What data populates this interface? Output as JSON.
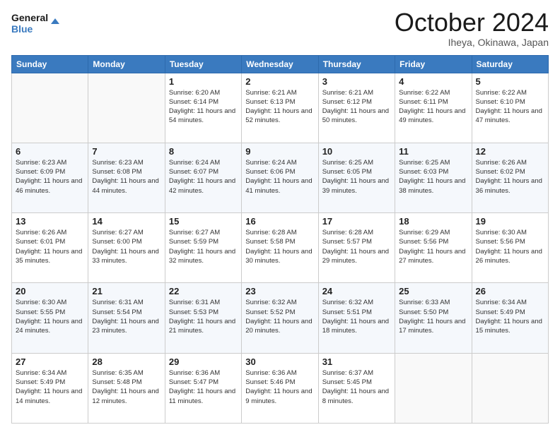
{
  "header": {
    "logo_line1": "General",
    "logo_line2": "Blue",
    "month_title": "October 2024",
    "location": "Iheya, Okinawa, Japan"
  },
  "weekdays": [
    "Sunday",
    "Monday",
    "Tuesday",
    "Wednesday",
    "Thursday",
    "Friday",
    "Saturday"
  ],
  "weeks": [
    [
      {
        "day": "",
        "info": ""
      },
      {
        "day": "",
        "info": ""
      },
      {
        "day": "1",
        "info": "Sunrise: 6:20 AM\nSunset: 6:14 PM\nDaylight: 11 hours and 54 minutes."
      },
      {
        "day": "2",
        "info": "Sunrise: 6:21 AM\nSunset: 6:13 PM\nDaylight: 11 hours and 52 minutes."
      },
      {
        "day": "3",
        "info": "Sunrise: 6:21 AM\nSunset: 6:12 PM\nDaylight: 11 hours and 50 minutes."
      },
      {
        "day": "4",
        "info": "Sunrise: 6:22 AM\nSunset: 6:11 PM\nDaylight: 11 hours and 49 minutes."
      },
      {
        "day": "5",
        "info": "Sunrise: 6:22 AM\nSunset: 6:10 PM\nDaylight: 11 hours and 47 minutes."
      }
    ],
    [
      {
        "day": "6",
        "info": "Sunrise: 6:23 AM\nSunset: 6:09 PM\nDaylight: 11 hours and 46 minutes."
      },
      {
        "day": "7",
        "info": "Sunrise: 6:23 AM\nSunset: 6:08 PM\nDaylight: 11 hours and 44 minutes."
      },
      {
        "day": "8",
        "info": "Sunrise: 6:24 AM\nSunset: 6:07 PM\nDaylight: 11 hours and 42 minutes."
      },
      {
        "day": "9",
        "info": "Sunrise: 6:24 AM\nSunset: 6:06 PM\nDaylight: 11 hours and 41 minutes."
      },
      {
        "day": "10",
        "info": "Sunrise: 6:25 AM\nSunset: 6:05 PM\nDaylight: 11 hours and 39 minutes."
      },
      {
        "day": "11",
        "info": "Sunrise: 6:25 AM\nSunset: 6:03 PM\nDaylight: 11 hours and 38 minutes."
      },
      {
        "day": "12",
        "info": "Sunrise: 6:26 AM\nSunset: 6:02 PM\nDaylight: 11 hours and 36 minutes."
      }
    ],
    [
      {
        "day": "13",
        "info": "Sunrise: 6:26 AM\nSunset: 6:01 PM\nDaylight: 11 hours and 35 minutes."
      },
      {
        "day": "14",
        "info": "Sunrise: 6:27 AM\nSunset: 6:00 PM\nDaylight: 11 hours and 33 minutes."
      },
      {
        "day": "15",
        "info": "Sunrise: 6:27 AM\nSunset: 5:59 PM\nDaylight: 11 hours and 32 minutes."
      },
      {
        "day": "16",
        "info": "Sunrise: 6:28 AM\nSunset: 5:58 PM\nDaylight: 11 hours and 30 minutes."
      },
      {
        "day": "17",
        "info": "Sunrise: 6:28 AM\nSunset: 5:57 PM\nDaylight: 11 hours and 29 minutes."
      },
      {
        "day": "18",
        "info": "Sunrise: 6:29 AM\nSunset: 5:56 PM\nDaylight: 11 hours and 27 minutes."
      },
      {
        "day": "19",
        "info": "Sunrise: 6:30 AM\nSunset: 5:56 PM\nDaylight: 11 hours and 26 minutes."
      }
    ],
    [
      {
        "day": "20",
        "info": "Sunrise: 6:30 AM\nSunset: 5:55 PM\nDaylight: 11 hours and 24 minutes."
      },
      {
        "day": "21",
        "info": "Sunrise: 6:31 AM\nSunset: 5:54 PM\nDaylight: 11 hours and 23 minutes."
      },
      {
        "day": "22",
        "info": "Sunrise: 6:31 AM\nSunset: 5:53 PM\nDaylight: 11 hours and 21 minutes."
      },
      {
        "day": "23",
        "info": "Sunrise: 6:32 AM\nSunset: 5:52 PM\nDaylight: 11 hours and 20 minutes."
      },
      {
        "day": "24",
        "info": "Sunrise: 6:32 AM\nSunset: 5:51 PM\nDaylight: 11 hours and 18 minutes."
      },
      {
        "day": "25",
        "info": "Sunrise: 6:33 AM\nSunset: 5:50 PM\nDaylight: 11 hours and 17 minutes."
      },
      {
        "day": "26",
        "info": "Sunrise: 6:34 AM\nSunset: 5:49 PM\nDaylight: 11 hours and 15 minutes."
      }
    ],
    [
      {
        "day": "27",
        "info": "Sunrise: 6:34 AM\nSunset: 5:49 PM\nDaylight: 11 hours and 14 minutes."
      },
      {
        "day": "28",
        "info": "Sunrise: 6:35 AM\nSunset: 5:48 PM\nDaylight: 11 hours and 12 minutes."
      },
      {
        "day": "29",
        "info": "Sunrise: 6:36 AM\nSunset: 5:47 PM\nDaylight: 11 hours and 11 minutes."
      },
      {
        "day": "30",
        "info": "Sunrise: 6:36 AM\nSunset: 5:46 PM\nDaylight: 11 hours and 9 minutes."
      },
      {
        "day": "31",
        "info": "Sunrise: 6:37 AM\nSunset: 5:45 PM\nDaylight: 11 hours and 8 minutes."
      },
      {
        "day": "",
        "info": ""
      },
      {
        "day": "",
        "info": ""
      }
    ]
  ]
}
